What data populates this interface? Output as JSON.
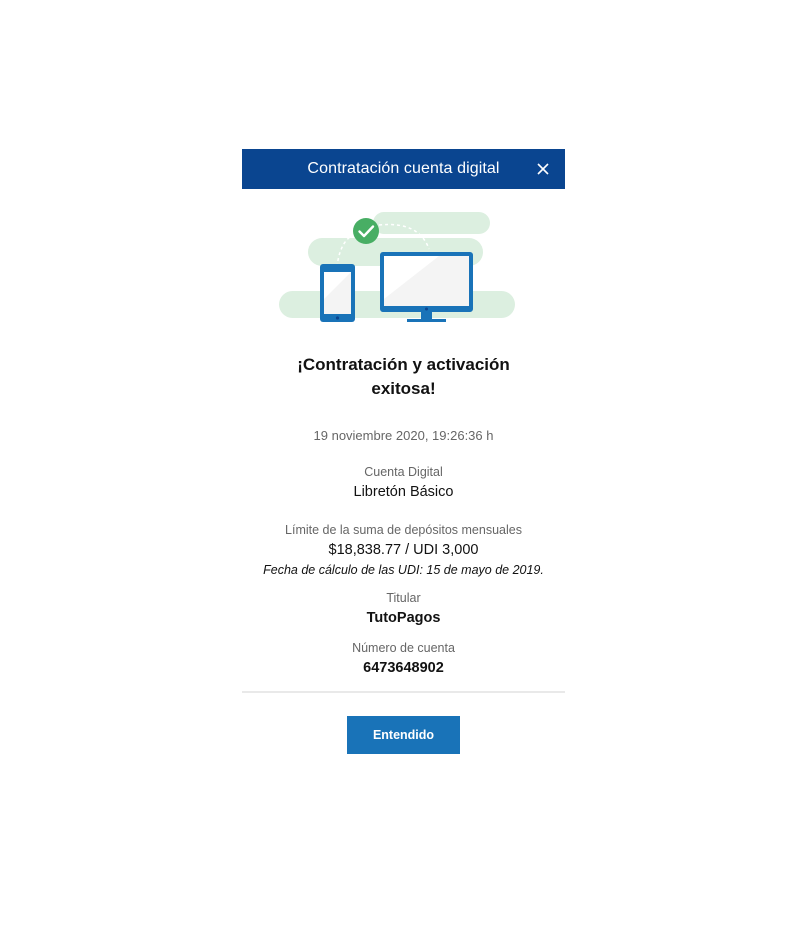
{
  "modal": {
    "title": "Contratación cuenta digital",
    "close_icon": "close-icon"
  },
  "illustration": {
    "check_icon": "check-circle-icon",
    "devices": [
      "tablet-icon",
      "monitor-icon"
    ],
    "colors": {
      "accent_green": "#48ae64",
      "bubble_green": "#dcefe0",
      "device_blue": "#1973b8",
      "screen_gray": "#f4f4f4"
    }
  },
  "success": {
    "title": "¡Contratación y activación exitosa!",
    "timestamp": "19 noviembre 2020, 19:26:36 h"
  },
  "details": {
    "account": {
      "label": "Cuenta Digital",
      "value": "Libretón Básico"
    },
    "limit": {
      "label": "Límite de la suma de depósitos mensuales",
      "value": "$18,838.77 / UDI 3,000",
      "note": "Fecha de cálculo de las UDI: 15 de mayo de 2019."
    },
    "holder": {
      "label": "Titular",
      "value": "TutoPagos"
    },
    "account_number": {
      "label": "Número de cuenta",
      "value": "6473648902"
    }
  },
  "actions": {
    "confirm_label": "Entendido"
  },
  "colors": {
    "header_bg": "#0a4590",
    "primary_button": "#1973b8",
    "divider": "#e9e9e9"
  }
}
